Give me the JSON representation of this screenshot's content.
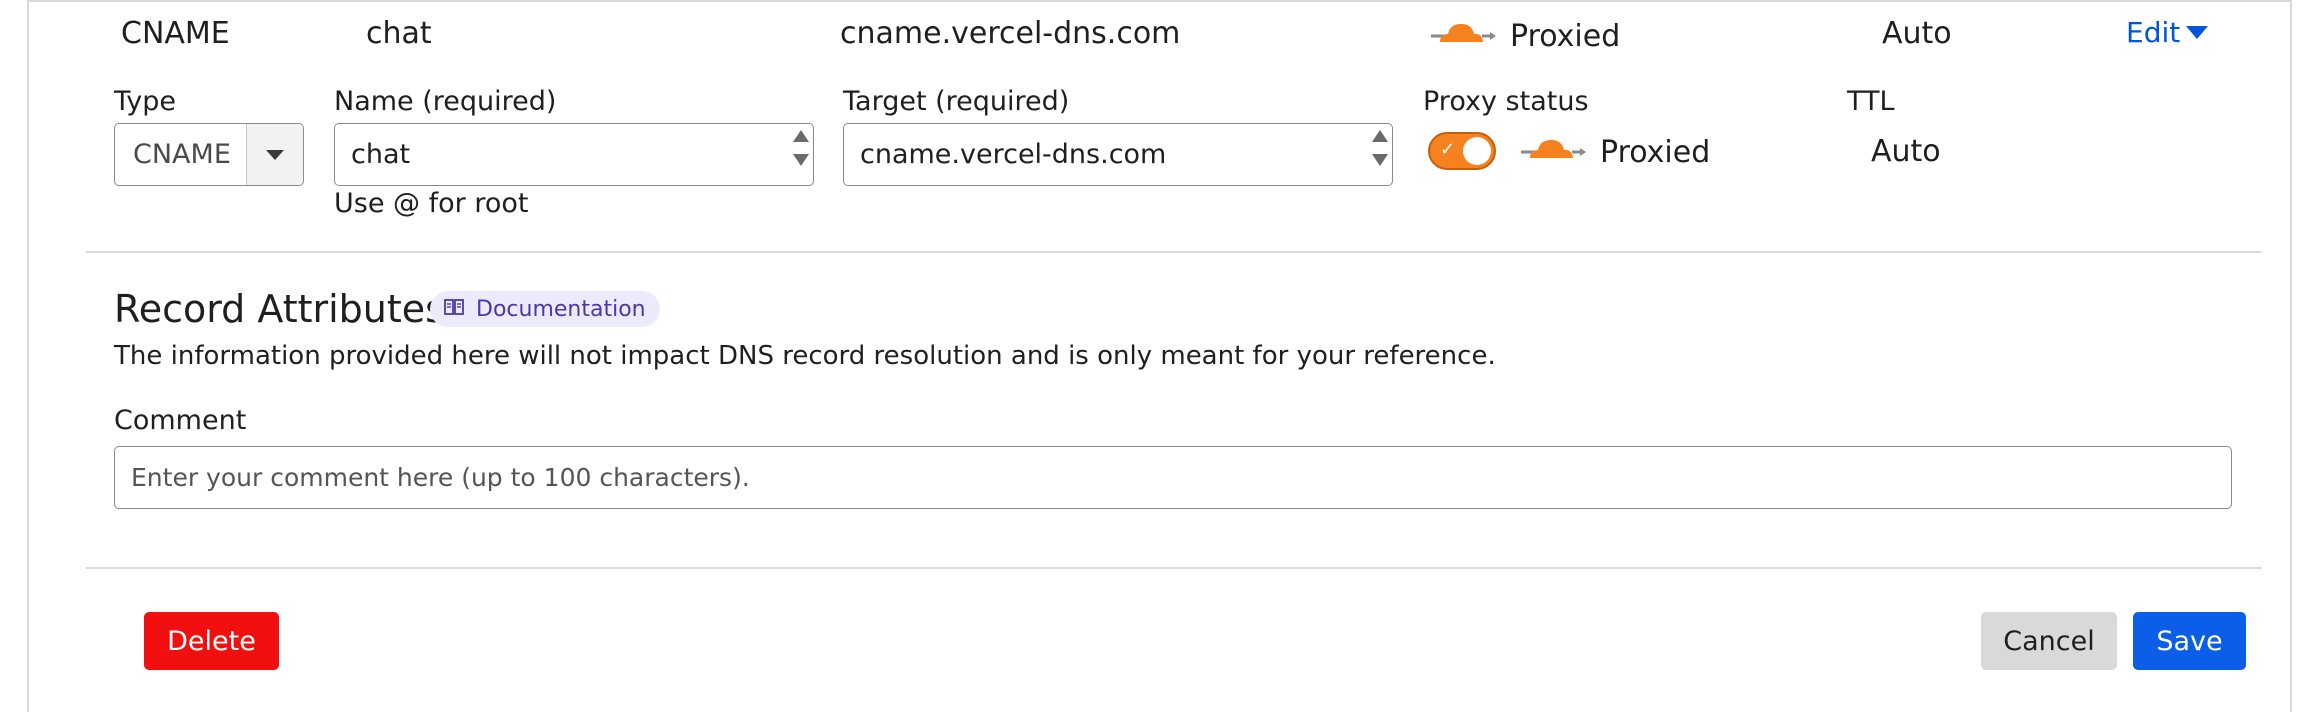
{
  "summary": {
    "type": "CNAME",
    "name": "chat",
    "target": "cname.vercel-dns.com",
    "proxy": "Proxied",
    "ttl": "Auto",
    "edit_label": "Edit"
  },
  "form": {
    "type_label": "Type",
    "type_value": "CNAME",
    "name_label": "Name (required)",
    "name_value": "chat",
    "name_hint": "Use @ for root",
    "target_label": "Target (required)",
    "target_value": "cname.vercel-dns.com",
    "proxy_label": "Proxy status",
    "proxy_value": "Proxied",
    "proxy_enabled": true,
    "ttl_label": "TTL",
    "ttl_value": "Auto"
  },
  "attributes": {
    "heading": "Record Attributes",
    "doc_label": "Documentation",
    "description": "The information provided here will not impact DNS record resolution and is only meant for your reference.",
    "comment_label": "Comment",
    "comment_placeholder": "Enter your comment here (up to 100 characters)."
  },
  "actions": {
    "delete": "Delete",
    "cancel": "Cancel",
    "save": "Save"
  },
  "colors": {
    "accent_orange": "#f6821f",
    "link_blue": "#0055dc",
    "delete_red": "#f20f0f",
    "save_blue": "#0a5ee8"
  }
}
